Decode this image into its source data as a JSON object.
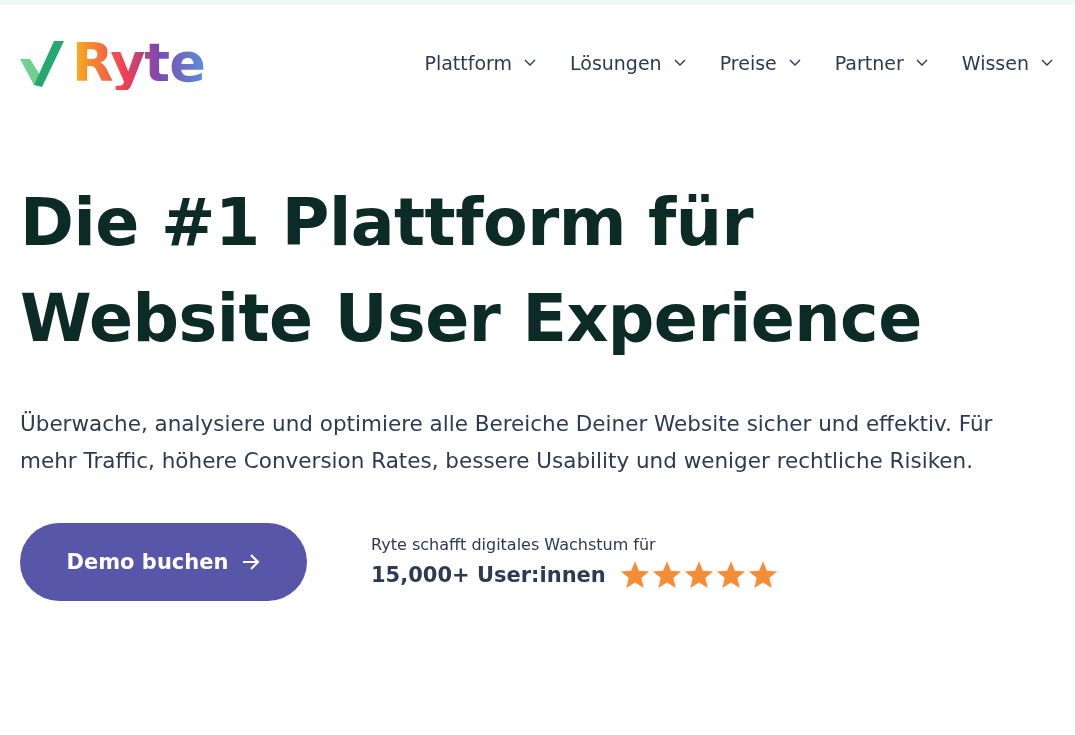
{
  "logo": {
    "text": "Ryte"
  },
  "nav": [
    {
      "label": "Plattform"
    },
    {
      "label": "Lösungen"
    },
    {
      "label": "Preise"
    },
    {
      "label": "Partner"
    },
    {
      "label": "Wissen"
    }
  ],
  "hero": {
    "headline": [
      "Die #1 Plattform für",
      "Website User Experience"
    ],
    "text": "Überwache, analysiere und optimiere alle Bereiche Deiner Website sicher und effektiv. Für mehr Traffic, höhere Conversion Rates, bessere Usability und weniger rechtliche Risiken.",
    "cta": "Demo buchen",
    "proof_caption": "Ryte schafft digitales Wachstum für",
    "proof_count": "15,000+ User:innen",
    "stars": 5
  }
}
